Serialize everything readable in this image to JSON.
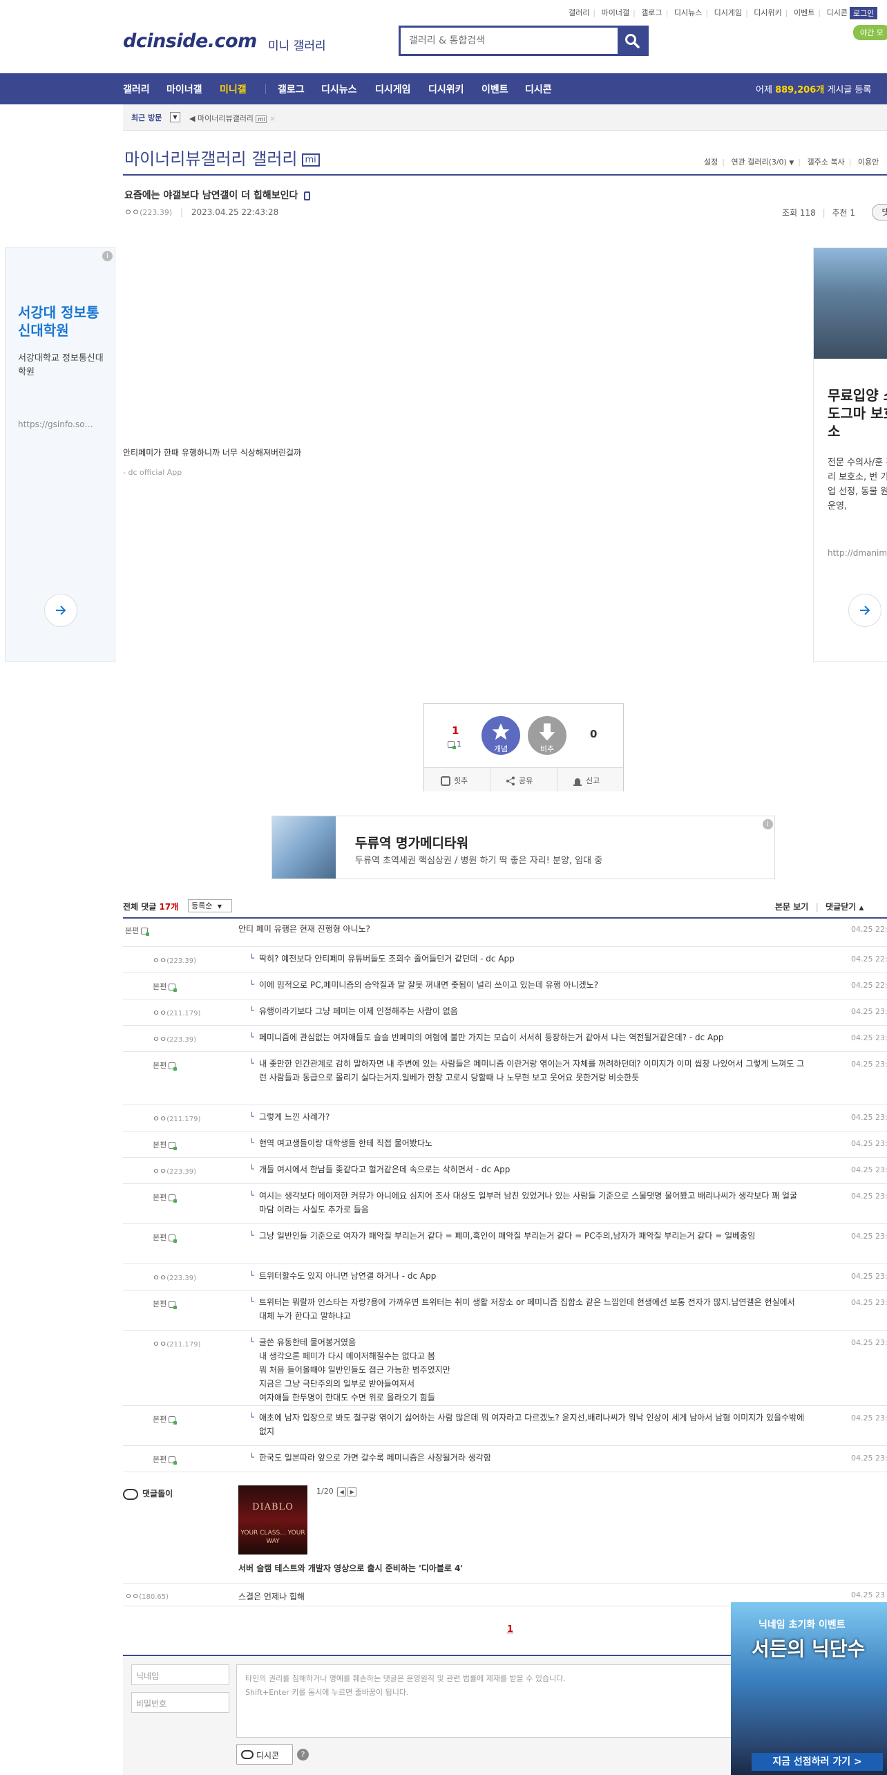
{
  "top_links": [
    "갤러리",
    "마이너갤",
    "갤로그",
    "디시뉴스",
    "디시게임",
    "디시위키",
    "이벤트",
    "디시콘"
  ],
  "login": "로그인",
  "ad_pill": "야간 모",
  "logo": "dcinside.com",
  "logo_sub": "미니 갤러리",
  "search": {
    "placeholder": "갤러리 & 통합검색"
  },
  "nav": {
    "items": [
      "갤러리",
      "마이너갤",
      "미니갤",
      "갤로그",
      "디시뉴스",
      "디시게임",
      "디시위키",
      "이벤트",
      "디시콘"
    ],
    "stat_prefix": "어제 ",
    "stat_count": "889,206개",
    "stat_suffix": " 게시글 등록"
  },
  "recent": {
    "label": "최근 방문",
    "item": "마이너리뷰갤러리"
  },
  "gallery": {
    "title": "마이너리뷰갤러리 갤러리",
    "badge": "mi",
    "tools": [
      "설정",
      "연관 갤러리(3/0)",
      "갤주소 복사",
      "이용안"
    ]
  },
  "post": {
    "title": "요즘에는 야갤보다 남연갤이 더 힙해보인다",
    "author": "ㅇㅇ",
    "ip": "(223.39)",
    "date": "2023.04.25 22:43:28",
    "views": "조회 118",
    "recommend": "추천 1",
    "comment_btn": "댓",
    "body": "안티페미가 한때 유행하니까 너무 식상해져버린걸까",
    "footer": "- dc official App"
  },
  "ad_left": {
    "title": "서강대 정보통신대학원",
    "desc": "서강대학교 정보통신대학원",
    "url": "https://gsinfo.so…"
  },
  "ad_right": {
    "title": "무료입양 소 도그마 보호소",
    "desc": "전문 수의사/훈 관리 보호소, 번 기업 선정, 동물 원운영,",
    "url": "http://dmanim"
  },
  "vote": {
    "up": "1",
    "up_fixed": "1",
    "gae": "개념",
    "bi": "비추",
    "down": "0",
    "btn_best": "힛추",
    "btn_share": "공유",
    "btn_report": "신고"
  },
  "ad_banner": {
    "title": "두류역 명가메디타워",
    "desc": "두류역 초역세권 핵심상권 / 병원 하기 딱 좋은 자리! 분양, 임대 중"
  },
  "comments_header": {
    "label": "전체 댓글 ",
    "count": "17개",
    "sort": "등록순",
    "view_post": "본문 보기",
    "close": "댓글닫기"
  },
  "comments": [
    {
      "nick": "본편",
      "ip": "",
      "gicon": true,
      "text": "안티 페미 유행은 현재 진행형 아니노?",
      "date": "04.25 22:4"
    },
    {
      "nick": "ㅇㅇ",
      "ip": "(223.39)",
      "gicon": false,
      "text": "딱히? 예전보다 안티페미 유튜버들도 조회수 줄어들던거 같던데 - dc App",
      "date": "04.25 22:5"
    },
    {
      "nick": "본편",
      "ip": "",
      "gicon": true,
      "text": "이에 밈적으로 PC,페미니즘의 승악질과 말 잘못 꺼내면 좆됨이 널리 쓰이고 있는데 유행 아니겠노?",
      "date": "04.25 22:5"
    },
    {
      "nick": "ㅇㅇ",
      "ip": "(211.179)",
      "gicon": false,
      "text": "유행이라기보다 그냥 페미는 이제 인정해주는 사람이 없음",
      "date": "04.25 23:0"
    },
    {
      "nick": "ㅇㅇ",
      "ip": "(223.39)",
      "gicon": false,
      "text": "페미니즘에 관심없는 여자애들도 슬슬 반페미의 여혐에 불만 가지는 모습이 서서히 등장하는거 같아서 나는 역전될거같은데? - dc App",
      "date": "04.25 23:0"
    },
    {
      "nick": "본편",
      "ip": "",
      "gicon": true,
      "text": "내 좆만한 인간관계로 감히 말하자면 내 주변에 있는 사람들은 페미니즘 이란거랑 엮이는거 자체를 꺼려하던데? 이미지가 이미 씹창 나있어서 그렇게 느껴도 그런 사람들과 동급으로 몰리기 싫다는거지.일베가 한창 고로시 당할때 나 노무현 보고 웃어요 못한거랑 비슷한듯",
      "date": "04.25 23:0"
    },
    {
      "nick": "ㅇㅇ",
      "ip": "(211.179)",
      "gicon": false,
      "text": "그렇게 느낀 사례가?",
      "date": "04.25 23:0"
    },
    {
      "nick": "본편",
      "ip": "",
      "gicon": true,
      "text": "현역 여고생들이랑 대학생들 한테 직접 물어봤다노",
      "date": "04.25 23:0"
    },
    {
      "nick": "ㅇㅇ",
      "ip": "(223.39)",
      "gicon": false,
      "text": "개들 여시에서 한남들 좆같다고 헐거같은데 속으로는 삭히면서 - dc App",
      "date": "04.25 23:0"
    },
    {
      "nick": "본편",
      "ip": "",
      "gicon": true,
      "text": "여시는 생각보다 메이저한 커뮤가 아니에요 심지어 조사 대상도 일부러 남친 있었거나 있는 사람들 기준으로 스물댓명 물어봤고 배리나씨가 생각보다 꽤 얼굴마담 이라는 사실도 추가로 들음",
      "date": "04.25 23:1"
    },
    {
      "nick": "본편",
      "ip": "",
      "gicon": true,
      "text": "그냥 일반인들 기준으로 여자가 패악질 부리는거 같다 = 페미,흑인이 패악질 부리는거 같다 = PC주의,남자가 패악질 부리는거 같다 = 일베충임",
      "date": "04.25 23:1"
    },
    {
      "nick": "ㅇㅇ",
      "ip": "(223.39)",
      "gicon": false,
      "text": "트위터할수도 있지 아니면 남연갤 하거나 - dc App",
      "date": "04.25 23:1"
    },
    {
      "nick": "본편",
      "ip": "",
      "gicon": true,
      "text": "트위터는 뭐랄까 인스타는 자랑?용에 가까우면 트위터는 취미 생활 저장소 or 페미니즘 집합소 같은 느낌인데 현생에선 보통 전자가 많지.남연갤은 현실에서 대체 누가 한다고 말하냐고",
      "date": "04.25 23:1"
    },
    {
      "nick": "ㅇㅇ",
      "ip": "(211.179)",
      "gicon": false,
      "text": "글쓴 유동한테 물어봉거였음\n내 생각으론 페미가 다시 메이저해질수는 없다고 봄\n뭐 처음 들어올때야 일반인들도 접근 가능한 범주였지만\n지금은 그냥 극단주의의 일부로 받아들여져서\n여자애들 한두명이 한대도 수면 위로 올라오기 힘들",
      "date": "04.25 23:1"
    },
    {
      "nick": "본편",
      "ip": "",
      "gicon": true,
      "text": "애초에 남자 입장으로 봐도 철구랑 엮이기 싫어하는 사람 많은데 뭐 여자라고 다르겠노? 윤지선,배리나씨가 워낙 인상이 세게 남아서 남혐 이미지가 있을수밖에 없지",
      "date": "04.25 23:1"
    },
    {
      "nick": "본편",
      "ip": "",
      "gicon": true,
      "text": "한국도 일본따라 앞으로 가면 갈수록 페미니즘은 사장될거라 생각함",
      "date": "04.25 23:2"
    }
  ],
  "dglr": {
    "label": "댓글돌이",
    "image_text": "DIABLO",
    "image_sub": "YOUR CLASS... YOUR WAY",
    "page": "1/20",
    "caption": "서버 슬램 테스트와 개발자 영상으로 출시 준비하는 '디아블로 4'",
    "row_nick": "ㅇㅇ",
    "row_ip": "(180.65)",
    "row_text": "스결은 언제나 힙해",
    "row_date": "04.25 23"
  },
  "pagination": {
    "current": "1"
  },
  "write": {
    "nick_placeholder": "닉네임",
    "pw_placeholder": "비밀번호",
    "textarea_line1": "타인의 권리를 침해하거나 명예를 훼손하는 댓글은 운영원칙 및 관련 법률에 제재를 받을 수 있습니다.",
    "textarea_line2": "Shift+Enter 키를 동시에 누르면 줄바꿈이 됩니다.",
    "dccon": "디시콘",
    "help": "?"
  },
  "game_ad": {
    "line1": "닉네임 초기화 이벤트",
    "line2": "서든의 닉단수",
    "cta": "지금 선점하러 가기 >"
  }
}
